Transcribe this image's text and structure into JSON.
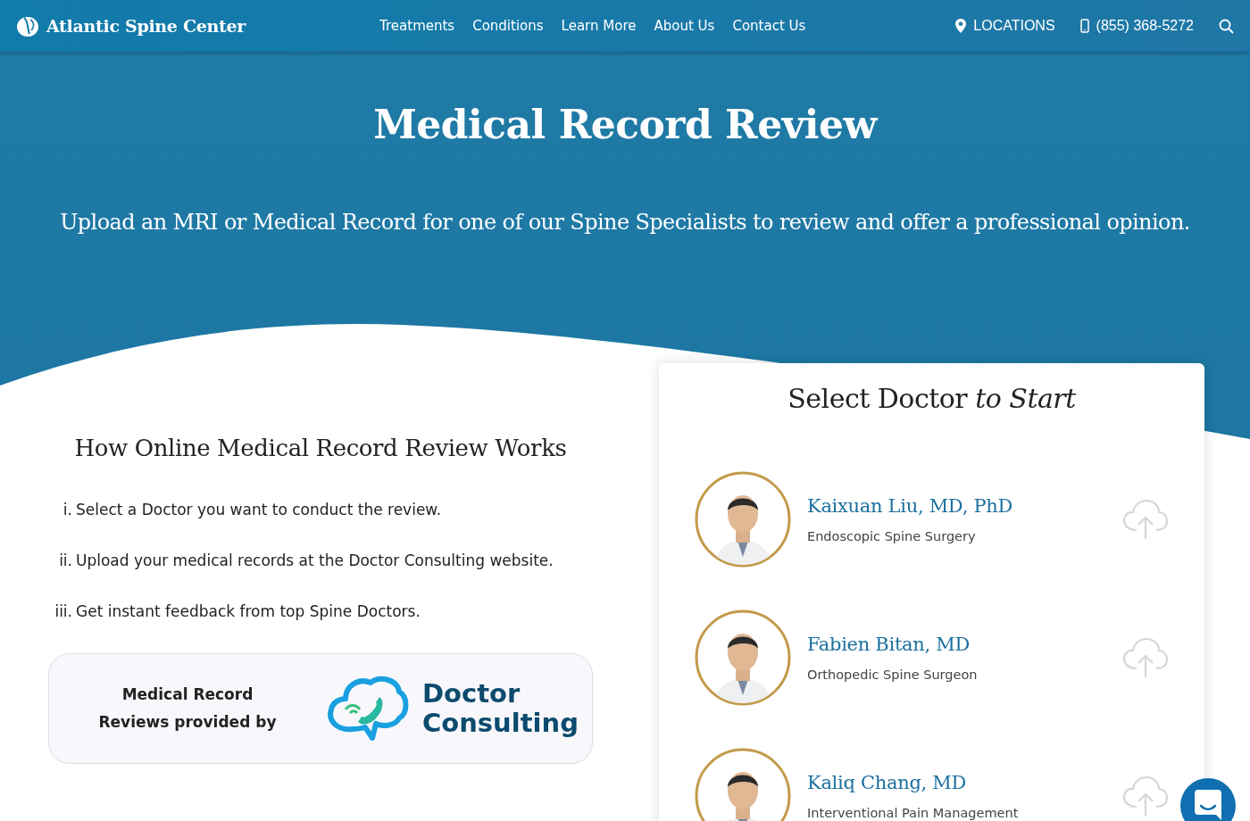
{
  "header": {
    "logo": "Atlantic Spine Center",
    "nav": [
      "Treatments",
      "Conditions",
      "Learn More",
      "About Us",
      "Contact Us"
    ],
    "locations": "LOCATIONS",
    "phone": "(855) 368-5272"
  },
  "hero": {
    "title": "Medical Record Review",
    "subtitle": "Upload an MRI or Medical Record for one of our Spine Specialists to review and offer a professional opinion."
  },
  "steps": {
    "title": "How Online Medical Record Review Works",
    "items": [
      {
        "marker": "i.",
        "text": "Select a Doctor you want to conduct the review."
      },
      {
        "marker": "ii.",
        "text": "Upload your medical records at the Doctor Consulting website."
      },
      {
        "marker": "iii.",
        "text": "Get instant feedback from top Spine Doctors."
      }
    ]
  },
  "provider": {
    "label_lines": [
      "Medical Record",
      "Reviews provided by"
    ],
    "brand_lines": [
      "Doctor",
      "Consulting"
    ]
  },
  "doctors": {
    "title": "Select Doctor",
    "title_emphasis": "to Start",
    "items": [
      {
        "name": "Kaixuan Liu, MD, PhD",
        "specialty": "Endoscopic Spine Surgery"
      },
      {
        "name": "Fabien Bitan, MD",
        "specialty": "Orthopedic Spine Surgeon"
      },
      {
        "name": "Kaliq Chang, MD",
        "specialty": "Interventional Pain Management"
      }
    ]
  }
}
